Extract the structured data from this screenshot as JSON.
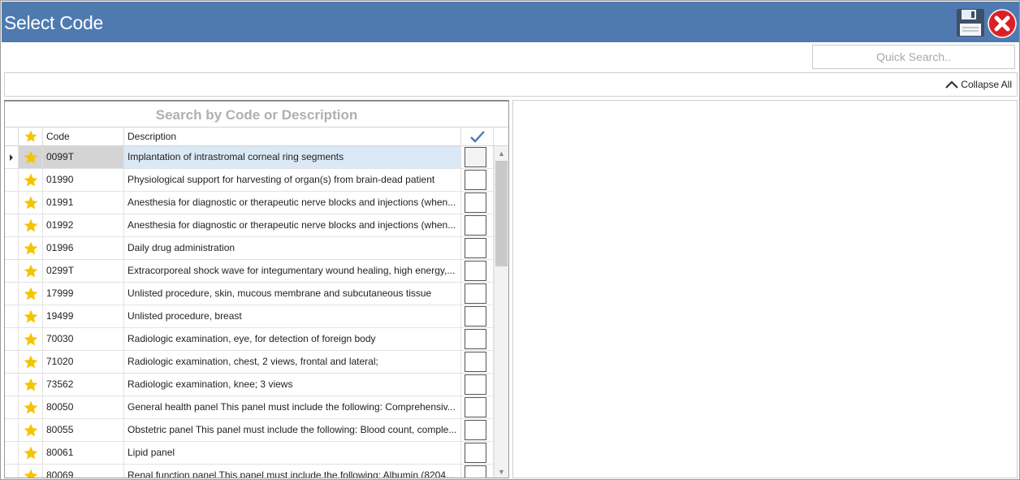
{
  "window": {
    "title": "Select Code",
    "save_icon": "save-floppy-icon",
    "close_icon": "close-circle-icon"
  },
  "quick_search": {
    "placeholder": "Quick Search..",
    "value": ""
  },
  "toolbar": {
    "collapse_all_label": "Collapse All",
    "collapse_icon": "chevron-up-icon"
  },
  "grid": {
    "caption": "Search by Code or Description",
    "columns": {
      "favorite_icon": "star-icon",
      "code": "Code",
      "description": "Description",
      "select_icon": "checkmark-icon"
    },
    "selected_index": 0,
    "rows": [
      {
        "code": "0099T",
        "description": "Implantation of intrastromal corneal ring segments",
        "checked": false
      },
      {
        "code": "01990",
        "description": "Physiological support for harvesting of organ(s) from brain-dead patient",
        "checked": false
      },
      {
        "code": "01991",
        "description": "Anesthesia for diagnostic or therapeutic nerve blocks and injections (when...",
        "checked": false
      },
      {
        "code": "01992",
        "description": "Anesthesia for diagnostic or therapeutic nerve blocks and injections (when...",
        "checked": false
      },
      {
        "code": "01996",
        "description": "Daily drug administration",
        "checked": false
      },
      {
        "code": "0299T",
        "description": "Extracorporeal shock wave for integumentary wound healing, high energy,...",
        "checked": false
      },
      {
        "code": "17999",
        "description": "Unlisted procedure, skin, mucous membrane and subcutaneous tissue",
        "checked": false
      },
      {
        "code": "19499",
        "description": "Unlisted procedure, breast",
        "checked": false
      },
      {
        "code": "70030",
        "description": "Radiologic examination, eye, for detection of foreign body",
        "checked": false
      },
      {
        "code": "71020",
        "description": "Radiologic examination, chest, 2 views, frontal and lateral;",
        "checked": false
      },
      {
        "code": "73562",
        "description": "Radiologic examination, knee; 3 views",
        "checked": false
      },
      {
        "code": "80050",
        "description": "General health panel This panel must include the following: Comprehensiv...",
        "checked": false
      },
      {
        "code": "80055",
        "description": "Obstetric panel This panel must include the following: Blood count, comple...",
        "checked": false
      },
      {
        "code": "80061",
        "description": "Lipid panel",
        "checked": false
      },
      {
        "code": "80069",
        "description": "Renal function panel This panel must include the following: Albumin (8204...",
        "checked": false
      }
    ]
  },
  "colors": {
    "titlebar": "#4f7ab0",
    "star": "#f5c400",
    "check": "#4a78b8",
    "selected_row": "#dbe8f6"
  }
}
